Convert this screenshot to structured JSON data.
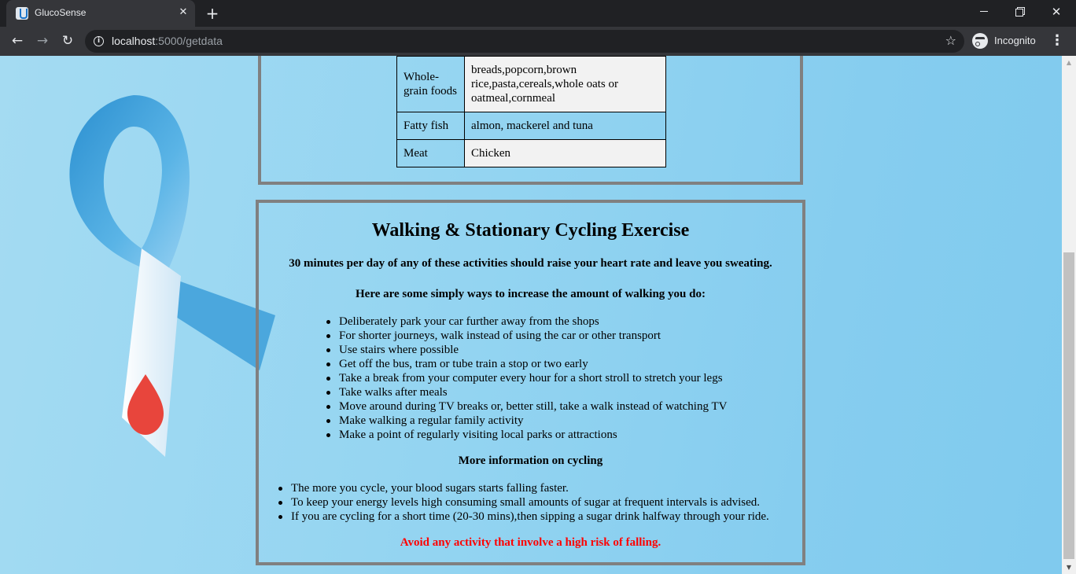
{
  "browser": {
    "tab_title": "GlucoSense",
    "tab_close": "✕",
    "new_tab": "+",
    "url_host": "localhost",
    "url_rest": ":5000/getdata",
    "incognito_label": "Incognito",
    "icons": [
      "app-favicon",
      "back-arrow-icon",
      "forward-arrow-icon",
      "reload-icon",
      "info-icon",
      "star-icon",
      "incognito-icon",
      "menu-icon"
    ]
  },
  "diet": {
    "rows": [
      {
        "category": "Whole-grain foods",
        "items": "breads,popcorn,brown rice,pasta,cereals,whole oats or oatmeal,cornmeal"
      },
      {
        "category": "Fatty fish",
        "items": "almon, mackerel and tuna"
      },
      {
        "category": "Meat",
        "items": "Chicken"
      }
    ]
  },
  "exercise": {
    "title": "Walking & Stationary Cycling Exercise",
    "subtitle": "30 minutes per day of any of these activities should raise your heart rate and leave you sweating.",
    "walking_heading": "Here are some simply ways to increase the amount of walking you do:",
    "walking_tips": [
      "Deliberately park your car further away from the shops",
      "For shorter journeys, walk instead of using the car or other transport",
      "Use stairs where possible",
      "Get off the bus, tram or tube train a stop or two early",
      "Take a break from your computer every hour for a short stroll to stretch your legs",
      "Take walks after meals",
      "Move around during TV breaks or, better still, take a walk instead of watching TV",
      "Make walking a regular family activity",
      "Make a point of regularly visiting local parks or attractions"
    ],
    "cycling_heading": "More information on cycling",
    "cycling_tips": [
      "The more you cycle, your blood sugars starts falling faster.",
      "To keep your energy levels high consuming small amounts of sugar at frequent intervals is advised.",
      "If you are cycling for a short time (20-30 mins),then sipping a sugar drink halfway through your ride."
    ],
    "warning": "Avoid any activity that involve a high risk of falling."
  },
  "colors": {
    "warning": "#ff0000",
    "panel_border": "#808080",
    "background": "#93d4f1"
  }
}
